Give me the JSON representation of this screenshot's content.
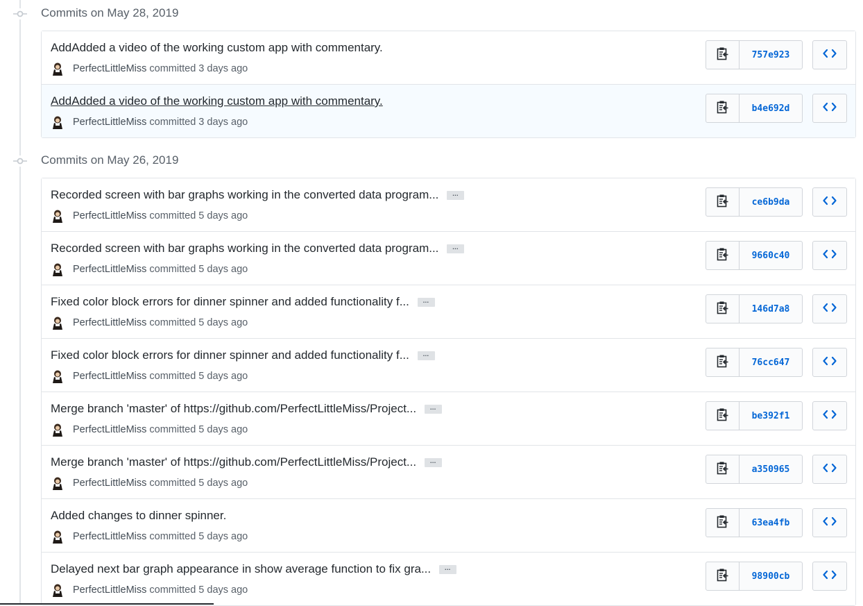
{
  "groups": [
    {
      "title": "Commits on May 28, 2019",
      "commits": [
        {
          "message": "AddAdded a video of the working custom app with commentary.",
          "author": "PerfectLittleMiss",
          "action": "committed",
          "time": "3 days ago",
          "sha": "757e923",
          "truncated": false
        },
        {
          "message": "AddAdded a video of the working custom app with commentary.",
          "author": "PerfectLittleMiss",
          "action": "committed",
          "time": "3 days ago",
          "sha": "b4e692d",
          "truncated": false
        }
      ]
    },
    {
      "title": "Commits on May 26, 2019",
      "commits": [
        {
          "message": "Recorded screen with bar graphs working in the converted data program...",
          "author": "PerfectLittleMiss",
          "action": "committed",
          "time": "5 days ago",
          "sha": "ce6b9da",
          "truncated": true
        },
        {
          "message": "Recorded screen with bar graphs working in the converted data program...",
          "author": "PerfectLittleMiss",
          "action": "committed",
          "time": "5 days ago",
          "sha": "9660c40",
          "truncated": true
        },
        {
          "message": "Fixed color block errors for dinner spinner and added functionality f...",
          "author": "PerfectLittleMiss",
          "action": "committed",
          "time": "5 days ago",
          "sha": "146d7a8",
          "truncated": true
        },
        {
          "message": "Fixed color block errors for dinner spinner and added functionality f...",
          "author": "PerfectLittleMiss",
          "action": "committed",
          "time": "5 days ago",
          "sha": "76cc647",
          "truncated": true
        },
        {
          "message": "Merge branch 'master' of https://github.com/PerfectLittleMiss/Project...",
          "author": "PerfectLittleMiss",
          "action": "committed",
          "time": "5 days ago",
          "sha": "be392f1",
          "truncated": true
        },
        {
          "message": "Merge branch 'master' of https://github.com/PerfectLittleMiss/Project...",
          "author": "PerfectLittleMiss",
          "action": "committed",
          "time": "5 days ago",
          "sha": "a350965",
          "truncated": true
        },
        {
          "message": "Added changes to dinner spinner.",
          "author": "PerfectLittleMiss",
          "action": "committed",
          "time": "5 days ago",
          "sha": "63ea4fb",
          "truncated": false
        },
        {
          "message": "Delayed next bar graph appearance in show average function to fix gra...",
          "author": "PerfectLittleMiss",
          "action": "committed",
          "time": "5 days ago",
          "sha": "98900cb",
          "truncated": true
        }
      ]
    }
  ],
  "ellipsis_label": "…",
  "hovered_commit_sha": "b4e692d",
  "icons": {
    "timeline": "git-commit-icon",
    "copy": "clippy-icon",
    "browse": "code-icon",
    "avatar": "avatar-icon"
  },
  "colors": {
    "link": "#0366d6",
    "border": "#e1e4e8",
    "hover_bg": "#f6fbff",
    "muted_text": "#586069"
  }
}
